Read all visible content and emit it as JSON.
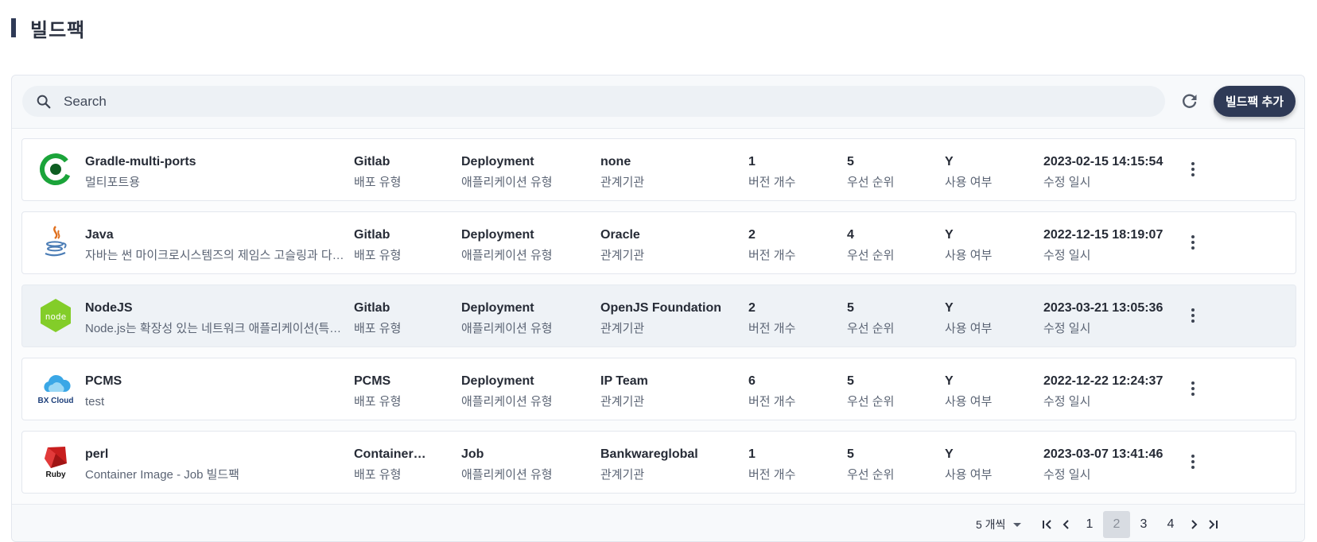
{
  "page": {
    "title": "빌드팩"
  },
  "toolbar": {
    "search_placeholder": "Search",
    "search_icon": "search-icon",
    "refresh_icon": "refresh-icon",
    "add_label": "빌드팩 추가"
  },
  "column_labels": {
    "deploy_type": "배포 유형",
    "app_type": "애플리케이션 유형",
    "org": "관계기관",
    "versions": "버전 개수",
    "priority": "우선 순위",
    "use": "사용 여부",
    "modified": "수정 일시"
  },
  "rows": [
    {
      "logo": "gradle-logo",
      "name": "Gradle-multi-ports",
      "desc": "멀티포트용",
      "deploy_type": "Gitlab",
      "app_type": "Deployment",
      "org": "none",
      "versions": "1",
      "priority": "5",
      "use": "Y",
      "modified": "2023-02-15 14:15:54",
      "selected": false
    },
    {
      "logo": "java-logo",
      "name": "Java",
      "desc": "자바는 썬 마이크로시스템즈의 제임스 고슬링과 다른 연구원들이 개발한 객체 지향적 프로그래밍 언어이다.",
      "deploy_type": "Gitlab",
      "app_type": "Deployment",
      "org": "Oracle",
      "versions": "2",
      "priority": "4",
      "use": "Y",
      "modified": "2022-12-15 18:19:07",
      "selected": false
    },
    {
      "logo": "nodejs-logo",
      "name": "NodeJS",
      "desc": "Node.js는 확장성 있는 네트워크 애플리케이션(특히 서버 사이드) 개발에 사용되는 소프트웨어 플랫폼이다.",
      "deploy_type": "Gitlab",
      "app_type": "Deployment",
      "org": "OpenJS Foundation",
      "versions": "2",
      "priority": "5",
      "use": "Y",
      "modified": "2023-03-21 13:05:36",
      "selected": true
    },
    {
      "logo": "bxcloud-logo",
      "logo_text": "BX Cloud",
      "name": "PCMS",
      "desc": "test",
      "deploy_type": "PCMS",
      "app_type": "Deployment",
      "org": "IP Team",
      "versions": "6",
      "priority": "5",
      "use": "Y",
      "modified": "2022-12-22 12:24:37",
      "selected": false
    },
    {
      "logo": "ruby-logo",
      "logo_text": "Ruby",
      "name": "perl",
      "desc": "Container Image - Job 빌드팩",
      "deploy_type": "Container Image",
      "app_type": "Job",
      "org": "Bankwareglobal",
      "versions": "1",
      "priority": "5",
      "use": "Y",
      "modified": "2023-03-07 13:41:46",
      "selected": false
    }
  ],
  "pagination": {
    "page_size_label": "5 개씩",
    "pages": [
      "1",
      "2",
      "3",
      "4"
    ],
    "current_page": "2"
  },
  "colors": {
    "accent": "#2f3a56",
    "selected_row": "#eef2f6",
    "gradle_green": "#1ba43a",
    "node_green": "#83cd29",
    "ruby_red": "#c81e1e",
    "cloud_blue": "#3aa7e6"
  }
}
